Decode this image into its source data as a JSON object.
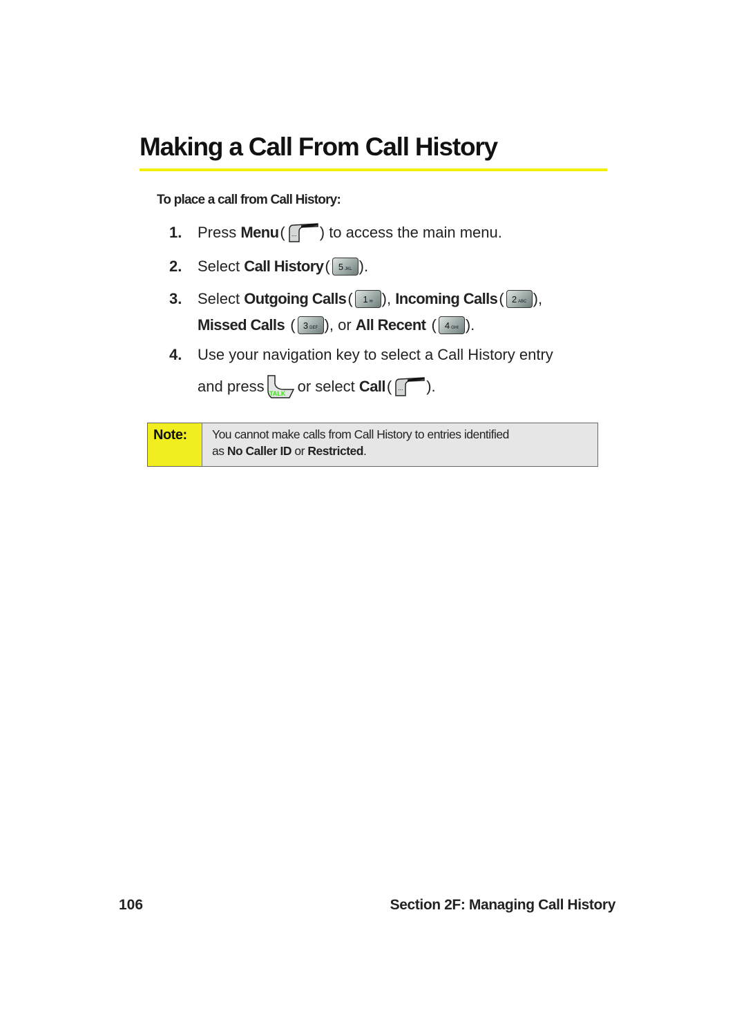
{
  "page": {
    "title": "Making a Call From Call History",
    "subheading": "To place a call from Call History:",
    "accent_color": "#f2ee00"
  },
  "steps": [
    {
      "number": "1.",
      "pre": "Press ",
      "bold": "Menu",
      "open": " (",
      "icon": "menu-softkey-icon",
      "post": ") to access the main menu."
    },
    {
      "number": "2.",
      "pre": "Select ",
      "bold": "Call History",
      "open": " (",
      "key": {
        "digit": "5",
        "letters": "JKL"
      },
      "post": ")."
    },
    {
      "number": "3.",
      "pre": "Select ",
      "items": [
        {
          "label": "Outgoing Calls",
          "key": {
            "digit": "1",
            "letters": "✉"
          },
          "sep": "), "
        },
        {
          "label": "Incoming Calls",
          "key": {
            "digit": "2",
            "letters": "ABC"
          },
          "sep": "),"
        },
        {
          "label": "Missed Calls",
          "key": {
            "digit": "3",
            "letters": "DEF"
          },
          "sep": "), or "
        },
        {
          "label": "All Recent",
          "key": {
            "digit": "4",
            "letters": "GHI"
          },
          "sep": ")."
        }
      ]
    },
    {
      "number": "4.",
      "line1": "Use your navigation key to select a Call History entry",
      "line2_pre": "and press ",
      "talk_label": "TALK",
      "line2_mid": " or select ",
      "bold": "Call",
      "open": " (",
      "post": ")."
    }
  ],
  "note": {
    "label": "Note:",
    "text_line1": "You cannot make calls from Call History to entries identified",
    "text_pre": "as ",
    "bold1": "No Caller ID",
    "mid": " or ",
    "bold2": "Restricted",
    "end": ".",
    "label_bg": "#f0ee1e",
    "box_bg": "#e6e6e6"
  },
  "footer": {
    "page_number": "106",
    "section": "Section 2F: Managing Call History"
  }
}
